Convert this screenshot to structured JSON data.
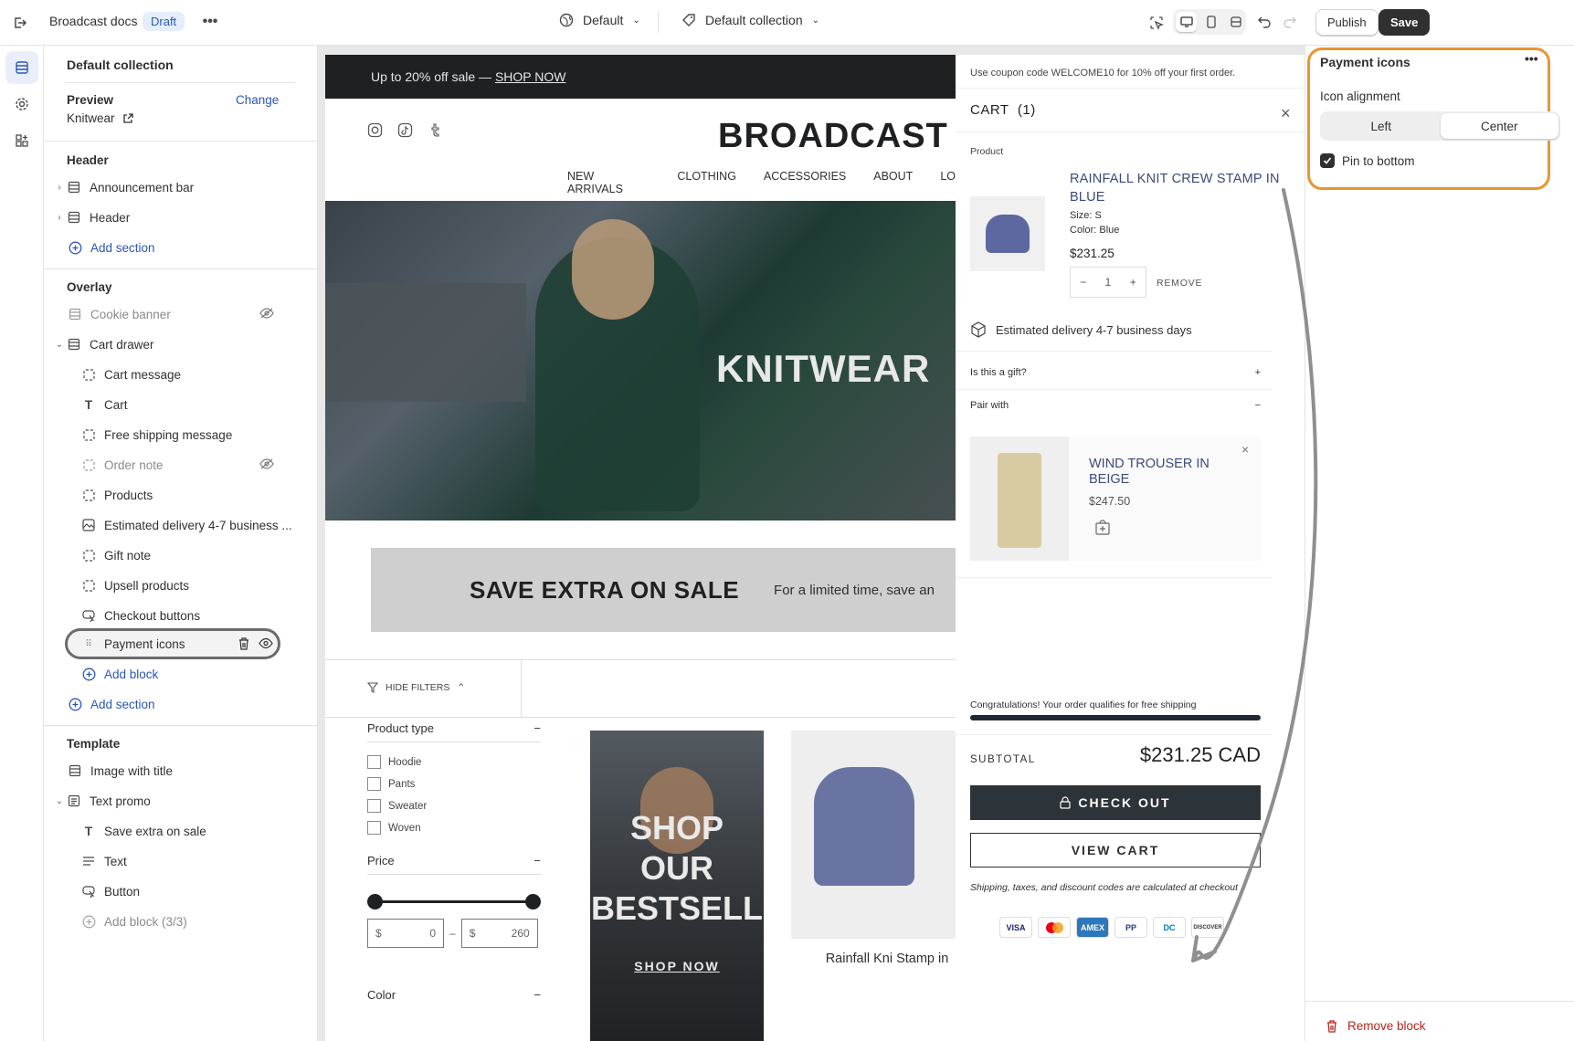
{
  "topbar": {
    "title": "Broadcast docs",
    "status": "Draft",
    "theme_selector": "Default",
    "template_selector": "Default collection",
    "publish_label": "Publish",
    "save_label": "Save"
  },
  "sidebar": {
    "collection_title": "Default collection",
    "preview_label": "Preview",
    "preview_change": "Change",
    "preview_value": "Knitwear",
    "header_group": {
      "title": "Header",
      "items": [
        "Announcement bar",
        "Header"
      ],
      "add_section": "Add section"
    },
    "overlay_group": {
      "title": "Overlay",
      "cookie": "Cookie banner",
      "cart_drawer": "Cart drawer",
      "blocks": [
        "Cart message",
        "Cart",
        "Free shipping message",
        "Order note",
        "Products",
        "Estimated delivery 4-7 business ...",
        "Gift note",
        "Upsell products",
        "Checkout buttons",
        "Payment icons"
      ],
      "add_block": "Add block",
      "add_section": "Add section"
    },
    "template_group": {
      "title": "Template",
      "items": [
        "Image with title",
        "Text promo"
      ],
      "blocks": [
        "Save extra on sale",
        "Text",
        "Button"
      ],
      "add_block": "Add block (3/3)"
    }
  },
  "store": {
    "announcement": "Up to 20% off sale —",
    "announcement_link": "SHOP NOW",
    "logo": "BROADCAST",
    "nav": [
      "NEW ARRIVALS",
      "CLOTHING",
      "ACCESSORIES",
      "ABOUT",
      "LO"
    ],
    "hero_title": "KNITWEAR",
    "promo_title": "SAVE EXTRA ON SALE",
    "promo_text": "For a limited time, save an",
    "hide_filters": "HIDE FILTERS",
    "filter_product_type": "Product type",
    "filter_options": [
      "Hoodie",
      "Pants",
      "Sweater",
      "Woven"
    ],
    "filter_price": "Price",
    "price_from_currency": "$",
    "price_from": "0",
    "price_to_currency": "$",
    "price_to": "260",
    "filter_color": "Color",
    "card1_overlay": "SHOP OUR BESTSELL",
    "card1_cta": "SHOP NOW",
    "card2_title": "Rainfall Kni Stamp in"
  },
  "cart": {
    "coupon": "Use coupon code WELCOME10 for 10% off your first order.",
    "title": "CART",
    "count": "(1)",
    "product_label": "Product",
    "item_name": "RAINFALL KNIT CREW STAMP IN BLUE",
    "item_size": "Size: S",
    "item_color": "Color: Blue",
    "item_price": "$231.25",
    "qty": "1",
    "qty_minus": "−",
    "qty_plus": "+",
    "remove": "REMOVE",
    "delivery": "Estimated delivery 4-7 business days",
    "gift": "Is this a gift?",
    "pair": "Pair with",
    "upsell_name": "WIND TROUSER IN BEIGE",
    "upsell_price": "$247.50",
    "free_shipping": "Congratulations! Your order qualifies for free shipping",
    "subtotal_label": "SUBTOTAL",
    "subtotal_value": "$231.25 CAD",
    "checkout": "CHECK OUT",
    "view_cart": "VIEW CART",
    "note": "Shipping, taxes, and discount codes are calculated at checkout",
    "payment_icons": [
      "VISA",
      "MC",
      "AMEX",
      "PP",
      "DC",
      "DISCOVER"
    ]
  },
  "inspector": {
    "title": "Payment icons",
    "icon_alignment": "Icon alignment",
    "left": "Left",
    "center": "Center",
    "pin": "Pin to bottom",
    "remove": "Remove block"
  },
  "colors": {
    "accent_orange": "#e8952f",
    "link_blue": "#2a56b8",
    "dark": "#303030"
  }
}
